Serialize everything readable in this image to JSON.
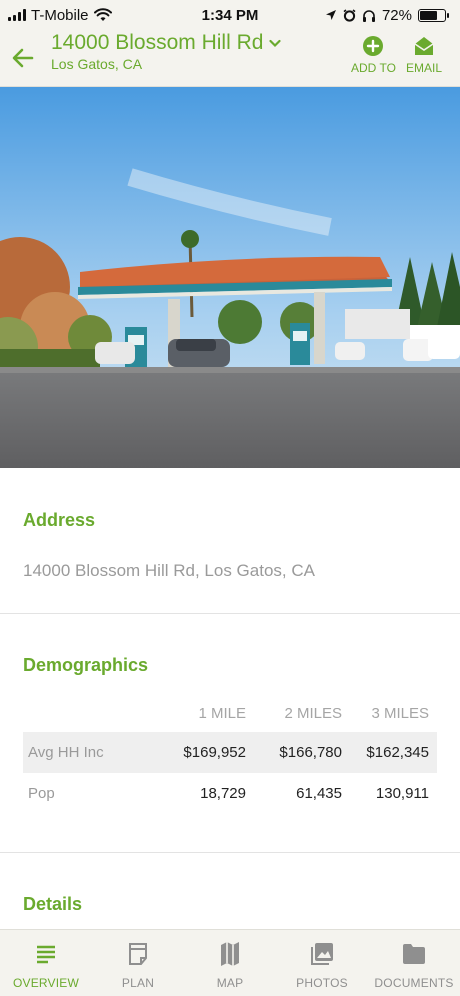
{
  "status_bar": {
    "carrier": "T-Mobile",
    "time": "1:34 PM",
    "battery": "72%",
    "battery_level": 0.72
  },
  "header": {
    "title": "14000 Blossom Hill Rd",
    "subtitle": "Los Gatos, CA",
    "add_label": "ADD TO",
    "email_label": "EMAIL"
  },
  "address": {
    "title": "Address",
    "value": "14000 Blossom Hill Rd, Los Gatos, CA"
  },
  "demographics": {
    "title": "Demographics",
    "columns": [
      "1 MILE",
      "2 MILES",
      "3 MILES"
    ],
    "rows": [
      {
        "label": "Avg HH Inc",
        "values": [
          "$169,952",
          "$166,780",
          "$162,345"
        ]
      },
      {
        "label": "Pop",
        "values": [
          "18,729",
          "61,435",
          "130,911"
        ]
      }
    ]
  },
  "details": {
    "title": "Details"
  },
  "tabs": [
    {
      "label": "OVERVIEW",
      "icon": "list-icon",
      "active": true
    },
    {
      "label": "PLAN",
      "icon": "plan-icon",
      "active": false
    },
    {
      "label": "MAP",
      "icon": "map-icon",
      "active": false
    },
    {
      "label": "PHOTOS",
      "icon": "photos-icon",
      "active": false
    },
    {
      "label": "DOCUMENTS",
      "icon": "folder-icon",
      "active": false
    }
  ],
  "colors": {
    "accent": "#6aaa2e",
    "bar_bg": "#f4f3ee"
  }
}
